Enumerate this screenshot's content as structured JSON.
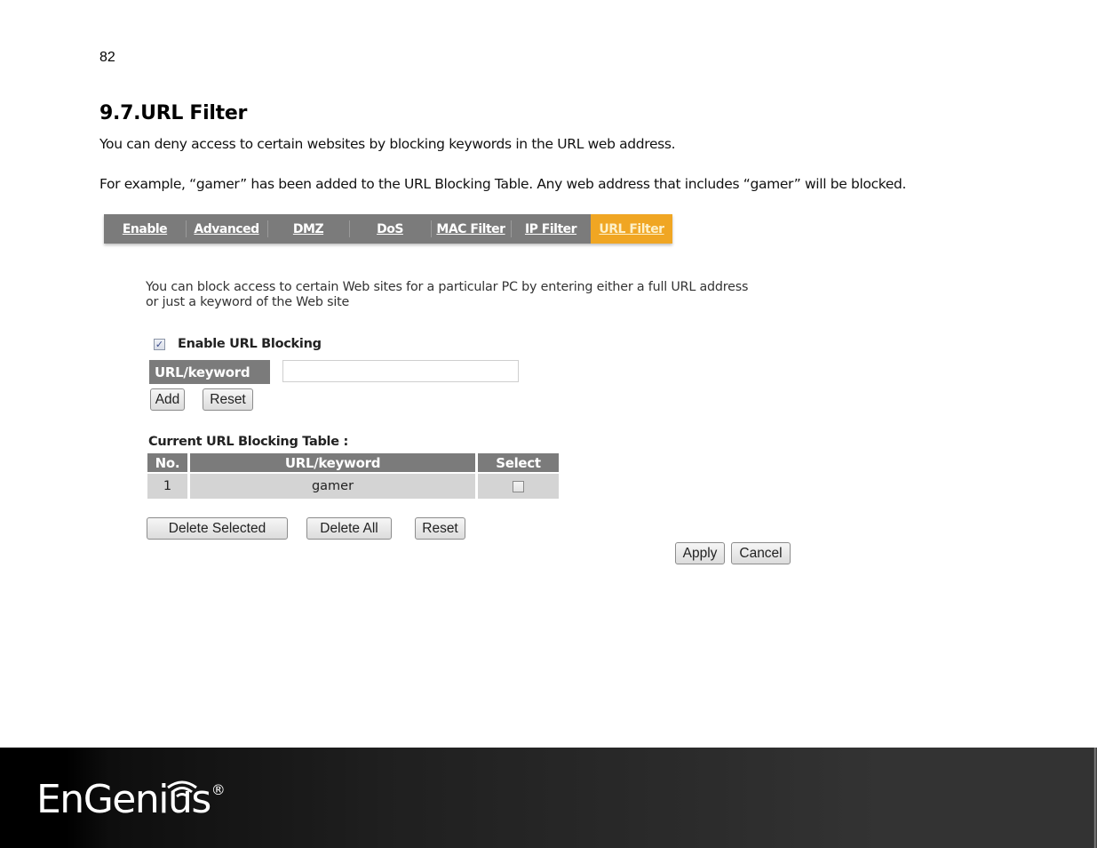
{
  "page_number": "82",
  "section": {
    "title": "9.7.URL Filter",
    "paragraphs": [
      "You can deny access to certain websites by blocking keywords in the URL web address.",
      "For example, “gamer” has been added to the URL Blocking Table. Any web address that includes “gamer” will be blocked."
    ]
  },
  "ui": {
    "tabs": [
      {
        "label": "Enable",
        "active": false
      },
      {
        "label": "Advanced",
        "active": false
      },
      {
        "label": "DMZ",
        "active": false
      },
      {
        "label": "DoS",
        "active": false
      },
      {
        "label": "MAC Filter",
        "active": false
      },
      {
        "label": "IP Filter",
        "active": false
      },
      {
        "label": "URL Filter",
        "active": true
      }
    ],
    "description_lines": [
      "You can block access to certain Web sites for a particular PC by entering either a full URL address",
      "or just a keyword of the Web site"
    ],
    "enable_checkbox": {
      "label": "Enable URL Blocking",
      "checked": true,
      "glyph": "✓"
    },
    "keyword_field": {
      "label": "URL/keyword",
      "value": "",
      "placeholder": ""
    },
    "buttons": {
      "add": "Add",
      "reset": "Reset",
      "delete_selected": "Delete Selected",
      "delete_all": "Delete All",
      "reset_table": "Reset",
      "apply": "Apply",
      "cancel": "Cancel"
    },
    "table": {
      "title": "Current URL Blocking Table :",
      "headers": [
        "No.",
        "URL/keyword",
        "Select"
      ],
      "rows": [
        {
          "no": "1",
          "keyword": "gamer",
          "selected": false
        }
      ]
    },
    "colors": {
      "tab_bg": "#7b7b7b",
      "tab_active": "#f0a623",
      "header_bg": "#7b7b7b",
      "cell_bg": "#d4d4d4"
    }
  },
  "footer": {
    "brand": "EnGenius",
    "registered_mark": "®"
  }
}
